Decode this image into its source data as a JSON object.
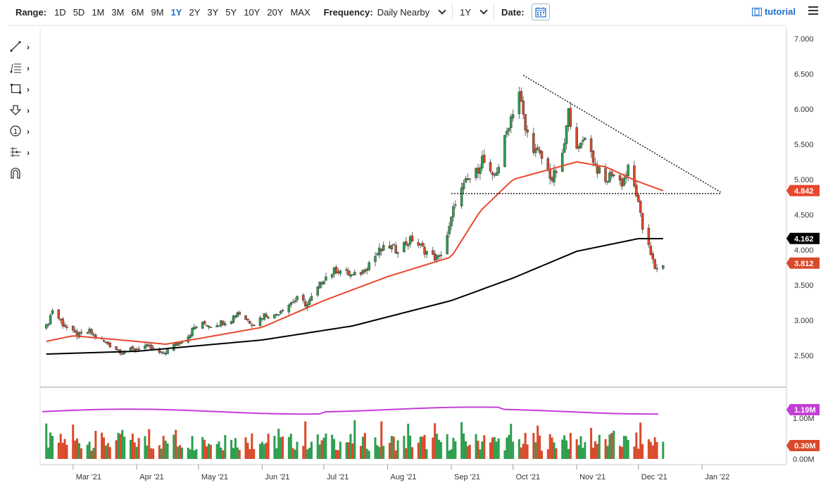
{
  "toolbar": {
    "range_label": "Range:",
    "ranges": [
      "1D",
      "5D",
      "1M",
      "3M",
      "6M",
      "9M",
      "1Y",
      "2Y",
      "3Y",
      "5Y",
      "10Y",
      "20Y",
      "MAX"
    ],
    "active_range": "1Y",
    "frequency_label": "Frequency:",
    "frequency_value": "Daily Nearby",
    "period_value": "1Y",
    "date_label": "Date:",
    "tutorial_label": "tutorial"
  },
  "drawing_tools": [
    {
      "icon": "trendline-icon"
    },
    {
      "icon": "fibonacci-icon"
    },
    {
      "icon": "rectangle-icon"
    },
    {
      "icon": "arrow-down-icon"
    },
    {
      "icon": "number-marker-icon",
      "label": "1"
    },
    {
      "icon": "measure-icon"
    },
    {
      "icon": "magnet-icon"
    }
  ],
  "colors": {
    "up": "#2e9e4f",
    "down": "#d94a2b",
    "ma50": "#e8482e",
    "ma200": "#000000",
    "vol_avg": "#c43ed6",
    "accent": "#1f6fd0"
  },
  "chart_data": {
    "type": "candlestick",
    "price_axis": {
      "ylim": [
        2.0,
        7.0
      ],
      "ticks": [
        "2.500",
        "3.000",
        "3.500",
        "4.000",
        "4.500",
        "5.000",
        "5.500",
        "6.000",
        "6.500",
        "7.000"
      ]
    },
    "x_axis": {
      "ticks": [
        "Mar '21",
        "Apr '21",
        "May '21",
        "Jun '21",
        "Jul '21",
        "Aug '21",
        "Sep '21",
        "Oct '21",
        "Nov '21",
        "Dec '21",
        "Jan '22"
      ]
    },
    "price_labels": [
      {
        "value": "4.842",
        "series": "ma50"
      },
      {
        "value": "4.162",
        "series": "ma200"
      },
      {
        "value": "3.812",
        "series": "last"
      }
    ],
    "close_series": [
      [
        "2021-02-16",
        2.9
      ],
      [
        "2021-02-19",
        3.15
      ],
      [
        "2021-02-24",
        2.95
      ],
      [
        "2021-03-01",
        2.82
      ],
      [
        "2021-03-04",
        2.78
      ],
      [
        "2021-03-09",
        2.84
      ],
      [
        "2021-03-12",
        2.76
      ],
      [
        "2021-03-17",
        2.68
      ],
      [
        "2021-03-22",
        2.6
      ],
      [
        "2021-03-25",
        2.55
      ],
      [
        "2021-03-30",
        2.58
      ],
      [
        "2021-04-05",
        2.63
      ],
      [
        "2021-04-08",
        2.6
      ],
      [
        "2021-04-13",
        2.52
      ],
      [
        "2021-04-16",
        2.57
      ],
      [
        "2021-04-21",
        2.68
      ],
      [
        "2021-04-26",
        2.78
      ],
      [
        "2021-04-29",
        2.9
      ],
      [
        "2021-05-04",
        2.95
      ],
      [
        "2021-05-07",
        2.93
      ],
      [
        "2021-05-12",
        2.97
      ],
      [
        "2021-05-17",
        3.02
      ],
      [
        "2021-05-20",
        3.12
      ],
      [
        "2021-05-25",
        3.0
      ],
      [
        "2021-05-28",
        2.95
      ],
      [
        "2021-06-02",
        3.08
      ],
      [
        "2021-06-07",
        3.06
      ],
      [
        "2021-06-10",
        3.15
      ],
      [
        "2021-06-15",
        3.25
      ],
      [
        "2021-06-18",
        3.3
      ],
      [
        "2021-06-23",
        3.22
      ],
      [
        "2021-06-28",
        3.45
      ],
      [
        "2021-07-01",
        3.6
      ],
      [
        "2021-07-07",
        3.72
      ],
      [
        "2021-07-12",
        3.68
      ],
      [
        "2021-07-15",
        3.62
      ],
      [
        "2021-07-20",
        3.7
      ],
      [
        "2021-07-23",
        3.82
      ],
      [
        "2021-07-28",
        3.98
      ],
      [
        "2021-08-02",
        4.05
      ],
      [
        "2021-08-05",
        4.0
      ],
      [
        "2021-08-10",
        4.1
      ],
      [
        "2021-08-13",
        4.15
      ],
      [
        "2021-08-18",
        4.02
      ],
      [
        "2021-08-23",
        3.9
      ],
      [
        "2021-08-26",
        3.88
      ],
      [
        "2021-08-31",
        4.3
      ],
      [
        "2021-09-03",
        4.7
      ],
      [
        "2021-09-08",
        4.95
      ],
      [
        "2021-09-13",
        5.1
      ],
      [
        "2021-09-16",
        5.3
      ],
      [
        "2021-09-21",
        5.0
      ],
      [
        "2021-09-24",
        5.2
      ],
      [
        "2021-09-29",
        5.8
      ],
      [
        "2021-10-04",
        6.25
      ],
      [
        "2021-10-07",
        5.7
      ],
      [
        "2021-10-12",
        5.4
      ],
      [
        "2021-10-15",
        5.3
      ],
      [
        "2021-10-20",
        5.0
      ],
      [
        "2021-10-25",
        5.3
      ],
      [
        "2021-10-28",
        5.95
      ],
      [
        "2021-11-02",
        5.4
      ],
      [
        "2021-11-05",
        5.65
      ],
      [
        "2021-11-10",
        5.2
      ],
      [
        "2021-11-15",
        4.95
      ],
      [
        "2021-11-18",
        5.1
      ],
      [
        "2021-11-23",
        4.95
      ],
      [
        "2021-11-26",
        5.15
      ],
      [
        "2021-11-30",
        4.8
      ],
      [
        "2021-12-03",
        4.3
      ],
      [
        "2021-12-06",
        4.1
      ],
      [
        "2021-12-09",
        3.7
      ],
      [
        "2021-12-13",
        3.81
      ]
    ],
    "ma50_series": [
      [
        "2021-02-16",
        2.7
      ],
      [
        "2021-03-01",
        2.78
      ],
      [
        "2021-04-01",
        2.7
      ],
      [
        "2021-04-15",
        2.66
      ],
      [
        "2021-05-01",
        2.74
      ],
      [
        "2021-06-01",
        2.9
      ],
      [
        "2021-07-01",
        3.28
      ],
      [
        "2021-08-01",
        3.62
      ],
      [
        "2021-09-01",
        3.9
      ],
      [
        "2021-09-15",
        4.55
      ],
      [
        "2021-10-01",
        5.0
      ],
      [
        "2021-11-01",
        5.25
      ],
      [
        "2021-11-15",
        5.18
      ],
      [
        "2021-11-30",
        4.98
      ],
      [
        "2021-12-13",
        4.84
      ]
    ],
    "ma200_series": [
      [
        "2021-02-16",
        2.52
      ],
      [
        "2021-04-01",
        2.56
      ],
      [
        "2021-06-01",
        2.72
      ],
      [
        "2021-07-15",
        2.92
      ],
      [
        "2021-09-01",
        3.28
      ],
      [
        "2021-10-01",
        3.6
      ],
      [
        "2021-11-01",
        3.98
      ],
      [
        "2021-12-01",
        4.16
      ],
      [
        "2021-12-13",
        4.16
      ]
    ],
    "annotations": {
      "resistance_line": [
        [
          "2021-09-01",
          4.8
        ],
        [
          "2022-01-10",
          4.8
        ]
      ],
      "trend_line": [
        [
          "2021-10-06",
          6.48
        ],
        [
          "2022-01-10",
          4.82
        ]
      ]
    },
    "volume_axis": {
      "ticks": [
        "0.00M",
        "1.00M"
      ]
    },
    "volume_labels": [
      {
        "value": "1.19M",
        "series": "vol_avg"
      },
      {
        "value": "0.30M",
        "series": "last_volume"
      }
    ],
    "volume_avg": 1.19,
    "volume_last": 0.3
  }
}
